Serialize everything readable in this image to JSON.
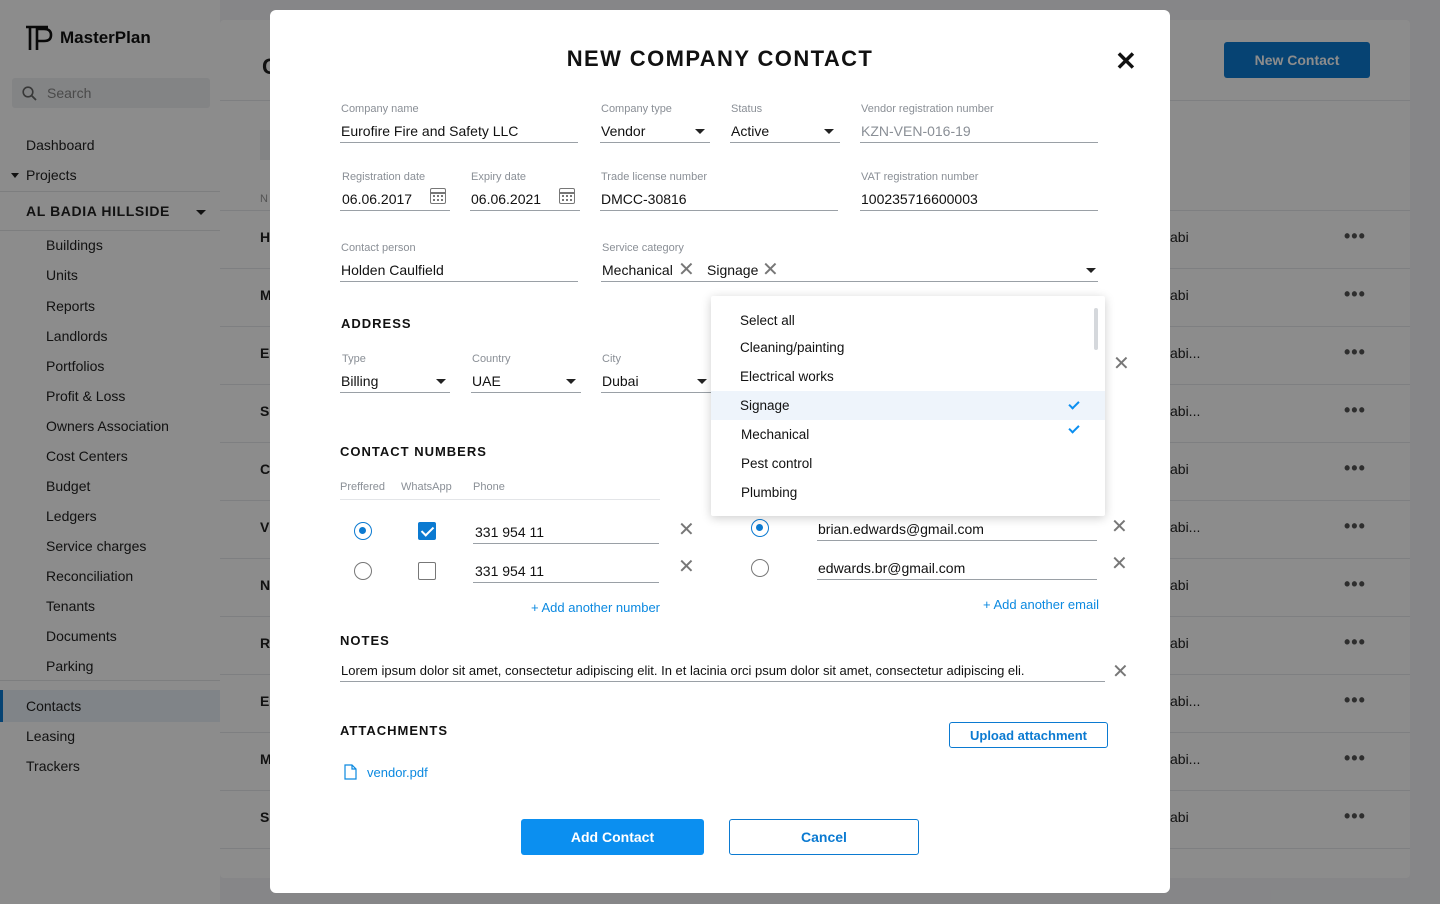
{
  "app": {
    "name": "MasterPlan"
  },
  "sidebar": {
    "search_placeholder": "Search",
    "dashboard": "Dashboard",
    "projects": "Projects",
    "project_name": "AL BADIA HILLSIDE",
    "project_items": [
      "Buildings",
      "Units",
      "Reports",
      "Landlords",
      "Portfolios",
      "Profit & Loss",
      "Owners Association",
      "Cost Centers",
      "Budget",
      "Ledgers",
      "Service charges",
      "Reconciliation",
      "Tenants",
      "Documents",
      "Parking"
    ],
    "contacts": "Contacts",
    "leasing": "Leasing",
    "trackers": "Trackers"
  },
  "background": {
    "new_contact_label": "New Contact",
    "header_letter": "C",
    "col_letter": "N",
    "row_letters": [
      "H",
      "M",
      "Ed",
      "Si",
      "Cl",
      "Vi",
      "N",
      "Ro",
      "Ed",
      "M",
      "Si"
    ],
    "row_cities": [
      "abi",
      "abi",
      "abi...",
      "abi...",
      "abi",
      "abi...",
      "abi",
      "abi",
      "abi...",
      "abi...",
      "abi"
    ],
    "row_menu": "•••"
  },
  "modal": {
    "title": "NEW COMPANY CONTACT",
    "close_icon": "close-icon",
    "company_name": {
      "label": "Company name",
      "value": "Eurofire Fire and Safety LLC"
    },
    "company_type": {
      "label": "Company type",
      "value": "Vendor"
    },
    "status": {
      "label": "Status",
      "value": "Active"
    },
    "vendor_reg": {
      "label": "Vendor registration number",
      "value": "KZN-VEN-016-19"
    },
    "registration_date": {
      "label": "Registration date",
      "value": "06.06.2017"
    },
    "expiry_date": {
      "label": "Expiry date",
      "value": "06.06.2021"
    },
    "trade_license": {
      "label": "Trade license number",
      "value": "DMCC-30816"
    },
    "vat_reg": {
      "label": "VAT registration number",
      "value": "100235716600003"
    },
    "contact_person": {
      "label": "Contact person",
      "value": "Holden Caulfield"
    },
    "service_category": {
      "label": "Service category",
      "chips": [
        "Mechanical",
        "Signage"
      ]
    },
    "address": {
      "title": "ADDRESS",
      "type": {
        "label": "Type",
        "value": "Billing"
      },
      "country": {
        "label": "Country",
        "value": "UAE"
      },
      "city": {
        "label": "City",
        "value": "Dubai"
      }
    },
    "contact_numbers": {
      "title": "CONTACT NUMBERS",
      "col_preferred": "Preffered",
      "col_whatsapp": "WhatsApp",
      "col_phone": "Phone",
      "phones": [
        {
          "value": "331 954 11",
          "preferred": true,
          "whatsapp": true
        },
        {
          "value": "331 954 11",
          "preferred": false,
          "whatsapp": false
        }
      ],
      "emails": [
        {
          "value": "brian.edwards@gmail.com",
          "preferred": true
        },
        {
          "value": "edwards.br@gmail.com",
          "preferred": false
        }
      ],
      "add_number": "+ Add another number",
      "add_email": "+ Add another email"
    },
    "notes": {
      "title": "NOTES",
      "value": "Lorem ipsum dolor sit amet, consectetur adipiscing elit. In et lacinia orci psum dolor sit amet, consectetur adipiscing eli."
    },
    "attachments": {
      "title": "ATTACHMENTS",
      "upload_label": "Upload attachment",
      "file": "vendor.pdf"
    },
    "add_contact_label": "Add Contact",
    "cancel_label": "Cancel"
  },
  "dropdown": {
    "options": [
      {
        "label": "Select all",
        "selected": false
      },
      {
        "label": "Cleaning/painting",
        "selected": false
      },
      {
        "label": "Electrical works",
        "selected": false
      },
      {
        "label": "Signage",
        "selected": true
      },
      {
        "label": "Mechanical",
        "selected": true
      },
      {
        "label": "Pest control",
        "selected": false
      },
      {
        "label": "Plumbing",
        "selected": false
      }
    ]
  },
  "colors": {
    "accent": "#0b8ff0",
    "overlay": "rgba(0,0,0,0.45)"
  }
}
